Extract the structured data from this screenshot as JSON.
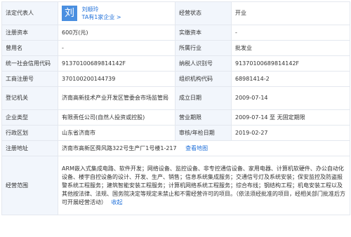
{
  "rows": [
    {
      "l1": "法定代表人",
      "v1_avatar": "刘",
      "v1_name": "刘顺玲",
      "v1_sub": "TA有1家企业 >",
      "l2": "经营状态",
      "v2": "开业"
    },
    {
      "l1": "注册资本",
      "v1": "600万(元)",
      "l2": "实缴资本",
      "v2": "-"
    },
    {
      "l1": "曾用名",
      "v1": "-",
      "l2": "所属行业",
      "v2": "批发业"
    },
    {
      "l1": "统一社会信用代码",
      "v1": "91370100689814142F",
      "l2": "纳税人识别号",
      "v2": "91370100689814142F"
    },
    {
      "l1": "工商注册号",
      "v1": "370100200144739",
      "l2": "组织机构代码",
      "v2": "68981414-2"
    },
    {
      "l1": "登记机关",
      "v1": "济南高新技术产业开发区管委会市场监管局",
      "l2": "成立日期",
      "v2": "2009-07-14"
    },
    {
      "l1": "企业类型",
      "v1": "有限责任公司(自然人投资或控股)",
      "l2": "营业期限",
      "v2": "2009-07-14 至 无固定期限"
    },
    {
      "l1": "行政区划",
      "v1": "山东省济南市",
      "l2": "审核/年检日期",
      "v2": "2019-02-27"
    }
  ],
  "address": {
    "label": "注册地址",
    "value": "济南市高新区舜风路322号生产厂1号楼1-217",
    "map_link": "查看地图"
  },
  "scope": {
    "label": "经营范围",
    "text": "ARM嵌入式集成电路、软件开发；网络设备、监控设备、非专控通信设备、家用电器、计算机软硬件、办公自动化设备、楼宇自控设备的设计、开发、生产、销售；信息系统集成服务；交通信号灯及系统安装；保安监控及防盗报警系统工程服务；建筑智能安装工程服务；计算机网络系统工程服务；综合布线；钢结构工程；机电安装工程以及其他按法律、法规、国务院决定等规定未禁止和不需经营许可的项目。（依法须经批准的项目，经相关部门批准后方可开展经营活动）",
    "more": "收起"
  }
}
